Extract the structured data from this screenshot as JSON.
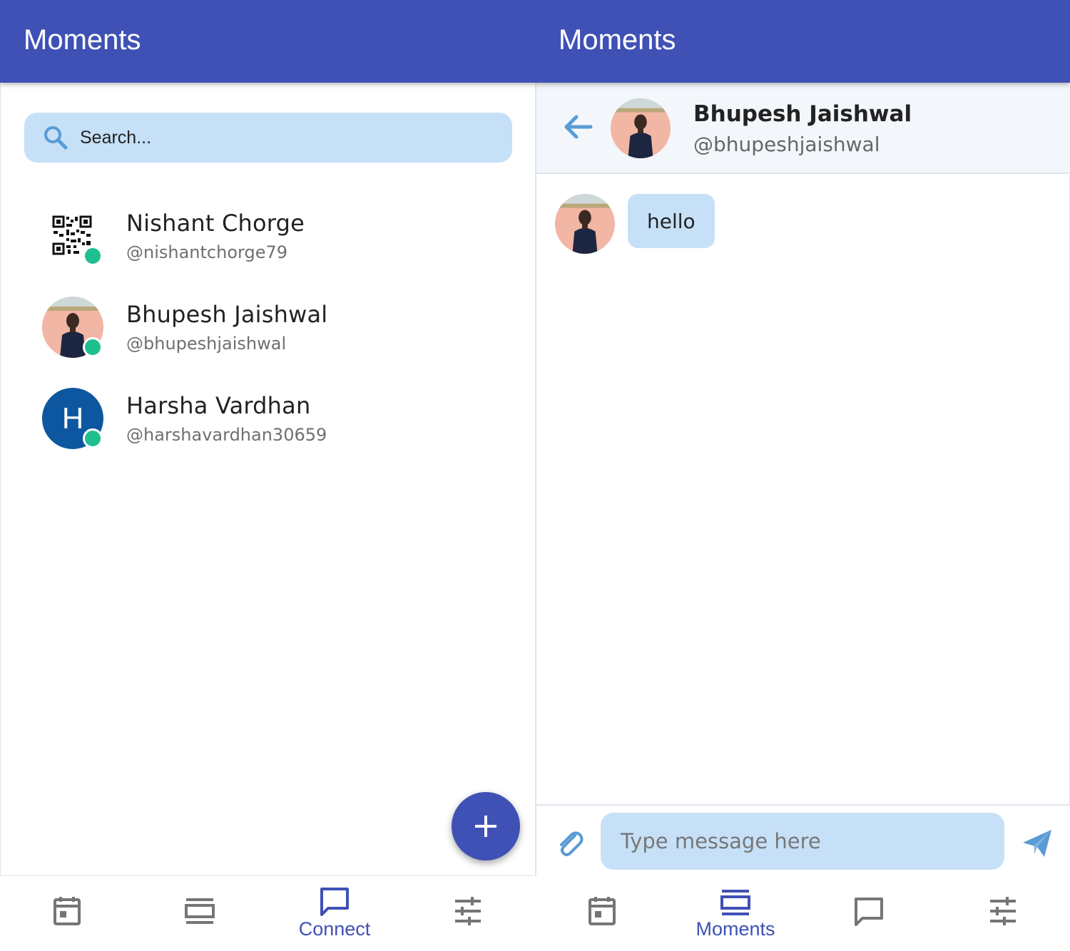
{
  "left_app": {
    "title": "Moments",
    "search": {
      "placeholder": "Search..."
    },
    "contacts": [
      {
        "name": "Nishant Chorge",
        "handle": "@nishantchorge79",
        "avatar": "qr-code-image",
        "online": true
      },
      {
        "name": "Bhupesh Jaishwal",
        "handle": "@bhupeshjaishwal",
        "avatar": "photo",
        "online": true
      },
      {
        "name": "Harsha Vardhan",
        "handle": "@harshavardhan30659",
        "avatar_letter": "H",
        "online": true
      }
    ],
    "fab_icon": "plus-icon",
    "nav": {
      "active": "Connect",
      "items": [
        {
          "icon": "calendar-icon"
        },
        {
          "icon": "moments-icon"
        },
        {
          "icon": "chat-icon",
          "label": "Connect"
        },
        {
          "icon": "settings-sliders-icon"
        }
      ]
    }
  },
  "right_app": {
    "title": "Moments",
    "chat": {
      "name": "Bhupesh Jaishwal",
      "handle": "@bhupeshjaishwal",
      "messages": [
        {
          "text": "hello",
          "from": "Bhupesh Jaishwal"
        }
      ]
    },
    "composer": {
      "placeholder": "Type message here"
    },
    "nav": {
      "active": "Moments",
      "items": [
        {
          "icon": "calendar-icon"
        },
        {
          "icon": "moments-icon",
          "label": "Moments"
        },
        {
          "icon": "chat-icon"
        },
        {
          "icon": "settings-sliders-icon"
        }
      ]
    }
  },
  "colors": {
    "primary": "#3f51b5",
    "input_bg": "#c6e0f7",
    "online": "#1fbf8f",
    "icon_blue": "#5a9bd4",
    "nav_inactive": "#757575"
  }
}
